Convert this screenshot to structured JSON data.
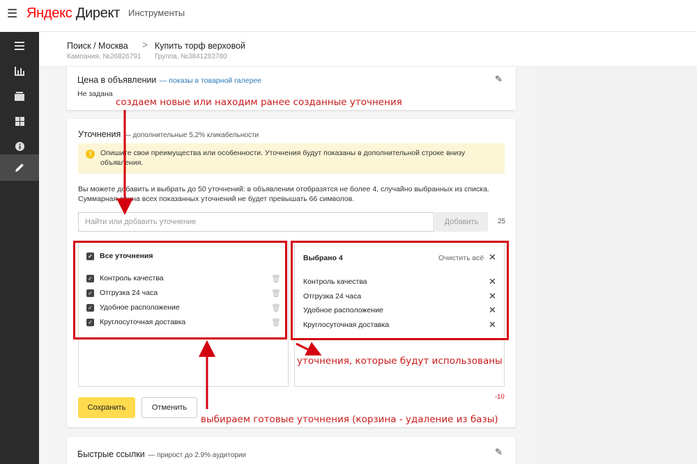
{
  "header": {
    "menu_icon": "hamburger-icon",
    "logo_yandex": "Яндекс",
    "logo_direct": "Директ",
    "tools": "Инструменты"
  },
  "rail": {
    "items": [
      {
        "icon": "list-icon"
      },
      {
        "icon": "bar-chart-icon"
      },
      {
        "icon": "stack-icon"
      },
      {
        "icon": "grid-icon"
      },
      {
        "icon": "info-icon"
      },
      {
        "icon": "pencil-icon",
        "active": true
      }
    ]
  },
  "breadcrumb": {
    "campaign_title": "Поиск / Москва",
    "campaign_sub": "Кампания, №26826791",
    "separator": ">",
    "group_title": "Купить торф верховой",
    "group_sub": "Группа, №3841283780"
  },
  "price_card": {
    "title": "Цена в объявлении",
    "subtitle": "— показы в товарной галерее",
    "value": "Не задана"
  },
  "refinements": {
    "title": "Уточнения",
    "subtitle": "— дополнительные 5,2% кликабельности",
    "notice": "Опишите свои преимущества или особенности. Уточнения будут показаны в дополнительной строке внизу объявления.",
    "description": "Вы можете добавить и выбрать до 50 уточнений: в объявлении отобразятся не более 4, случайно выбранных из списка. Суммарная длина всех показанных уточнений не будет превышать 66 символов.",
    "input_placeholder": "Найти или добавить уточнение",
    "add_label": "Добавить",
    "counter": "25",
    "all_label": "Все уточнения",
    "items": [
      "Контроль качества",
      "Отгрузка 24 часа",
      "Удобное расположение",
      "Круглосуточная доставка"
    ],
    "selected_label": "Выбрано 4",
    "clear_label": "Очистить всё",
    "selected_items": [
      "Контроль качества",
      "Отгрузка 24 часа",
      "Удобное расположение",
      "Круглосуточная доставка"
    ],
    "save_label": "Сохранить",
    "cancel_label": "Отменить",
    "remaining": "-10"
  },
  "links_card": {
    "title": "Быстрые ссылки",
    "subtitle": "— прирост до 2.9% аудитории"
  },
  "annotations": {
    "top": "создаем новые или находим ранее созданные уточнения",
    "right": "уточнения, которые будут использованы",
    "bottom": "выбираем готовые уточнения (корзина - удаление из базы)"
  },
  "colors": {
    "annotation_red": "#c81b1b",
    "save_yellow": "#ffdb4d",
    "link_blue": "#2a7ab8"
  }
}
